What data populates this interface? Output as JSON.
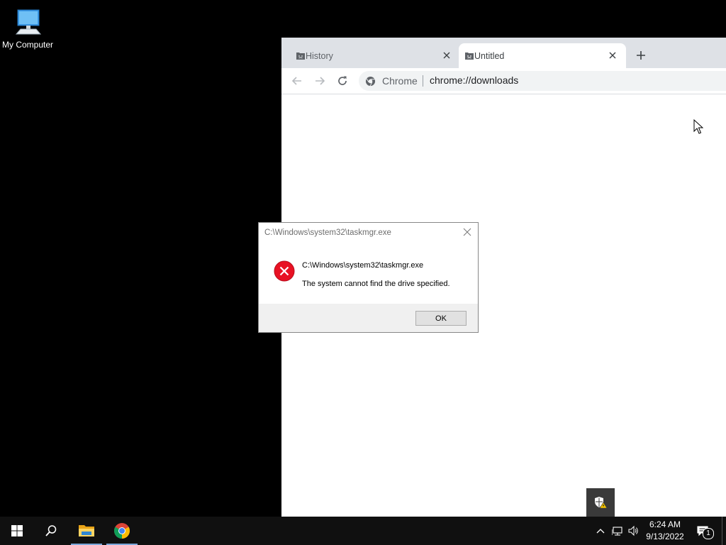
{
  "desktop": {
    "icons": [
      {
        "label": "My Computer",
        "icon": "computer-icon"
      }
    ]
  },
  "browser": {
    "tabs": [
      {
        "title": "History",
        "icon": "sad-folder-icon",
        "active": false
      },
      {
        "title": "Untitled",
        "icon": "sad-folder-icon",
        "active": true
      }
    ],
    "new_tab_icon": "plus-icon",
    "omnibox": {
      "site_chip": "Chrome",
      "url": "chrome://downloads"
    }
  },
  "dialog": {
    "title": "C:\\Windows\\system32\\taskmgr.exe",
    "path": "C:\\Windows\\system32\\taskmgr.exe",
    "message": "The system cannot find the drive specified.",
    "ok_label": "OK",
    "icon": "error-icon"
  },
  "taskbar": {
    "pinned": [
      {
        "name": "start",
        "icon": "windows-logo-icon"
      },
      {
        "name": "search",
        "icon": "search-icon"
      },
      {
        "name": "file-explorer",
        "icon": "folder-icon",
        "running": true
      },
      {
        "name": "chrome",
        "icon": "chrome-icon",
        "running": true
      }
    ],
    "clock": {
      "time": "6:24 AM",
      "date": "9/13/2022"
    },
    "notification_count": "1"
  },
  "colors": {
    "desktop_bg": "#000000",
    "taskbar_bg": "#101010",
    "error_red": "#e81123",
    "tab_strip": "#dee1e6"
  }
}
